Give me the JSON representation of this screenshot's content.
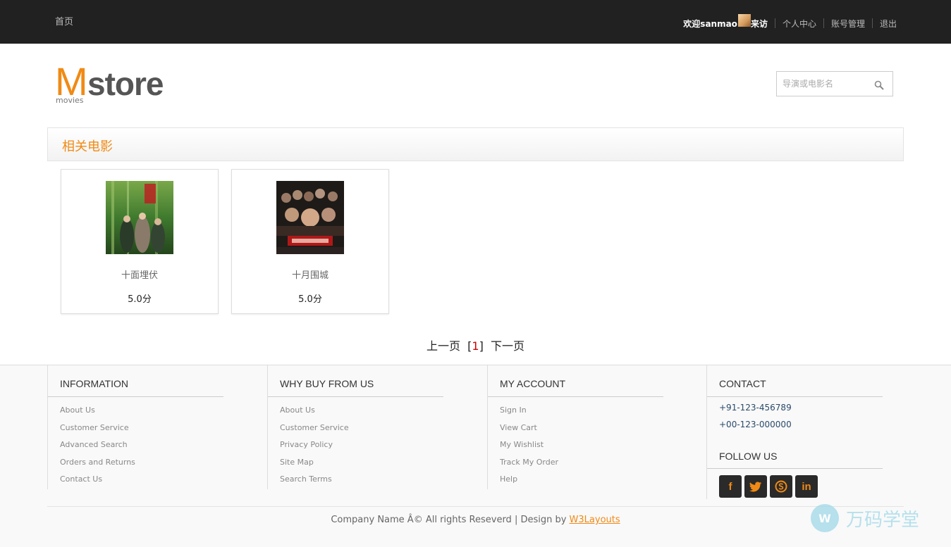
{
  "topbar": {
    "home": "首页",
    "welcome_prefix": "欢迎sanmao",
    "welcome_suffix": "来访",
    "links": [
      "个人中心",
      "账号管理",
      "退出"
    ]
  },
  "logo": {
    "m": "M",
    "store": "store",
    "sub": "movies"
  },
  "search": {
    "placeholder": "导演或电影名"
  },
  "section": {
    "title": "相关电影"
  },
  "movies": [
    {
      "name": "十面埋伏",
      "score": "5.0分"
    },
    {
      "name": "十月围城",
      "score": "5.0分"
    }
  ],
  "pager": {
    "prev": "上一页",
    "current": "1",
    "next": "下一页"
  },
  "footer": {
    "columns": [
      {
        "title": "INFORMATION",
        "items": [
          "About Us",
          "Customer Service",
          "Advanced Search",
          "Orders and Returns",
          "Contact Us"
        ]
      },
      {
        "title": "WHY BUY FROM US",
        "items": [
          "About Us",
          "Customer Service",
          "Privacy Policy",
          "Site Map",
          "Search Terms"
        ]
      },
      {
        "title": "MY ACCOUNT",
        "items": [
          "Sign In",
          "View Cart",
          "My Wishlist",
          "Track My Order",
          "Help"
        ]
      }
    ],
    "contact": {
      "title": "CONTACT",
      "phones": [
        "+91-123-456789",
        "+00-123-000000"
      ]
    },
    "follow": {
      "title": "FOLLOW US",
      "icons": [
        "facebook-icon",
        "twitter-icon",
        "skype-icon",
        "linkedin-icon"
      ]
    },
    "copyright_text": "Company Name Â© All rights Reseverd | Design by ",
    "copyright_link": "W3Layouts"
  },
  "watermark": {
    "text": "万码学堂"
  },
  "colors": {
    "accent": "#f08a15",
    "topbar": "#212121"
  }
}
